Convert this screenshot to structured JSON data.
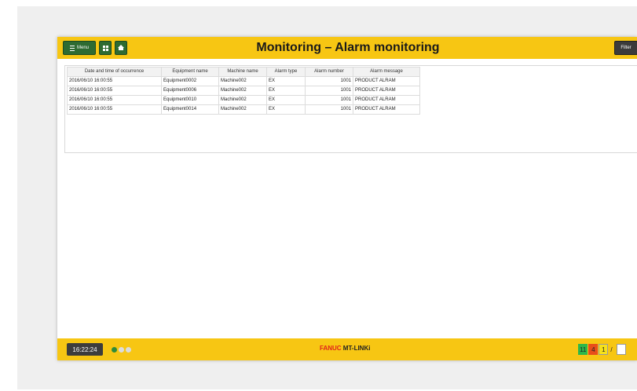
{
  "header": {
    "title": "Monitoring – Alarm monitoring",
    "menu_label": "Menu",
    "filter_label": "Filter"
  },
  "table": {
    "columns": [
      "Date and time of occurrence",
      "Equipment name",
      "Machine name",
      "Alarm type",
      "Alarm number",
      "Alarm message"
    ],
    "rows": [
      [
        "2016/06/10 16:00:55",
        "Equipment0002",
        "Machine002",
        "EX",
        "1001",
        "PRODUCT ALRAM"
      ],
      [
        "2016/06/10 16:00:55",
        "Equipment0006",
        "Machine002",
        "EX",
        "1001",
        "PRODUCT ALRAM"
      ],
      [
        "2016/06/10 16:00:55",
        "Equipment0010",
        "Machine002",
        "EX",
        "1001",
        "PRODUCT ALRAM"
      ],
      [
        "2016/06/10 16:00:55",
        "Equipment0014",
        "Machine002",
        "EX",
        "1001",
        "PRODUCT ALRAM"
      ]
    ]
  },
  "footer": {
    "clock": "16:22:24",
    "brand_fanuc": "FANUC",
    "brand_product": "MT-LINKi",
    "counts": {
      "green": "11",
      "red": "4",
      "yellow": "1",
      "slash": "/"
    }
  },
  "colors": {
    "bar": "#f7c613",
    "button": "#2e6b32",
    "status_green": "#2db84a",
    "status_red": "#e84e1b",
    "status_yellow": "#f7e21a"
  },
  "icons": [
    "hamburger-icon",
    "grid-icon",
    "home-icon"
  ]
}
